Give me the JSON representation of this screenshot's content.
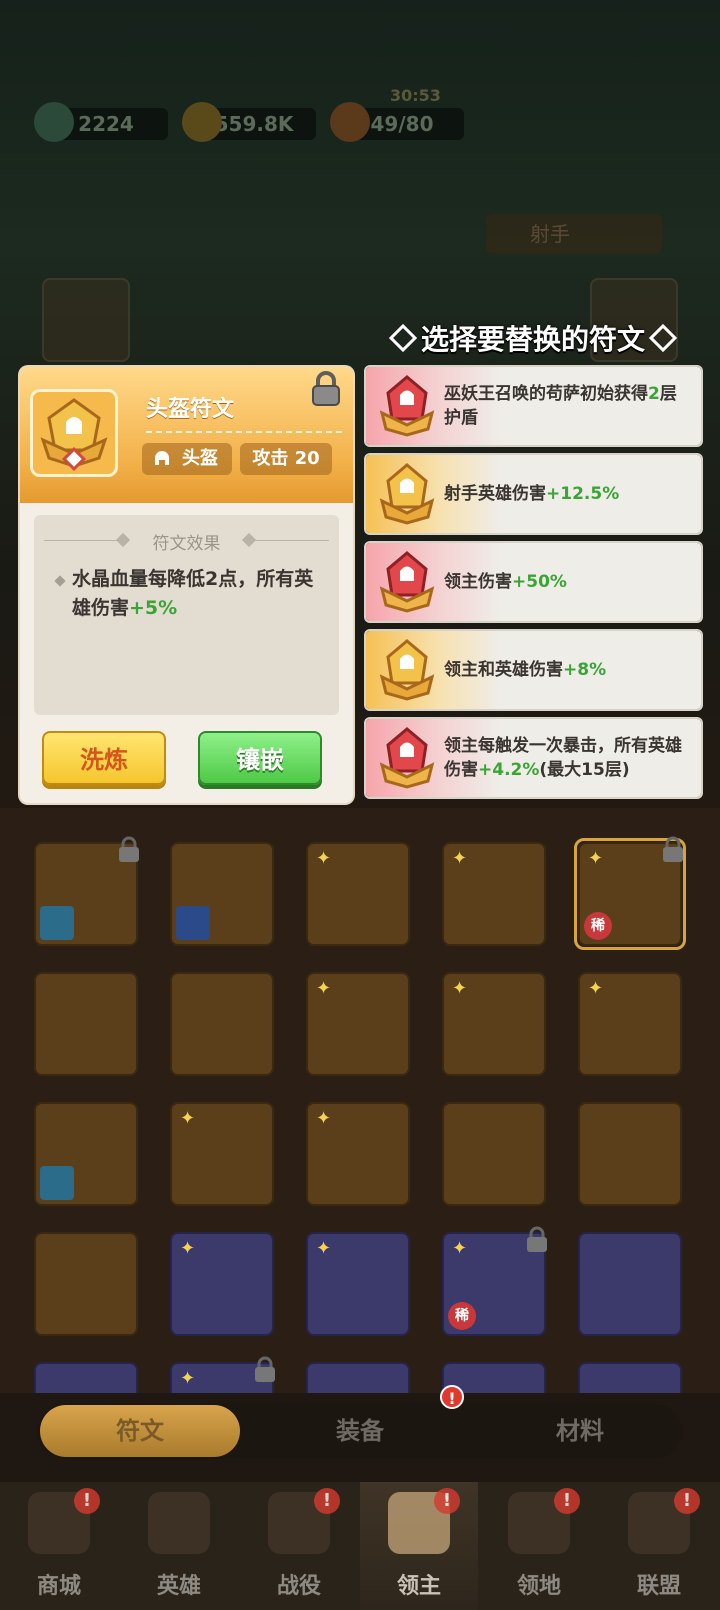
{
  "resources": {
    "gems": "2224",
    "gold": "559.8K",
    "stamina": "49/80",
    "timer": "30:53"
  },
  "header": {
    "class_select": "射手"
  },
  "choose_title": "选择要替换的符文",
  "rune_detail": {
    "title": "头盔符文",
    "part_tag": "头盔",
    "attack_tag": "攻击 20",
    "effect_header": "符文效果",
    "effect_text_prefix": "水晶血量每降低2点，所有英雄伤害",
    "effect_value": "+5%",
    "refine_button": "洗炼",
    "inlay_button": "镶嵌"
  },
  "options": [
    {
      "text": "巫妖王召唤的苟萨初始获得",
      "value": "2",
      "suffix": "层护盾",
      "color": "red"
    },
    {
      "text": "射手英雄伤害",
      "value": "+12.5%",
      "suffix": "",
      "color": "gold"
    },
    {
      "text": "领主伤害",
      "value": "+50%",
      "suffix": "",
      "color": "red"
    },
    {
      "text": "领主和英雄伤害",
      "value": "+8%",
      "suffix": "",
      "color": "gold"
    },
    {
      "text": "领主每触发一次暴击，所有英雄伤害",
      "value": "+4.2%",
      "suffix": "(最大15层)",
      "color": "red"
    }
  ],
  "inventory": {
    "rare_badge": "稀"
  },
  "category_tabs": [
    "符文",
    "装备",
    "材料"
  ],
  "nav": [
    "商城",
    "英雄",
    "战役",
    "领主",
    "领地",
    "联盟"
  ],
  "alert_mark": "!",
  "colors": {
    "gold_accent": "#f3b14a",
    "green_value": "#3aa535",
    "red_alert": "#e03a2e"
  }
}
